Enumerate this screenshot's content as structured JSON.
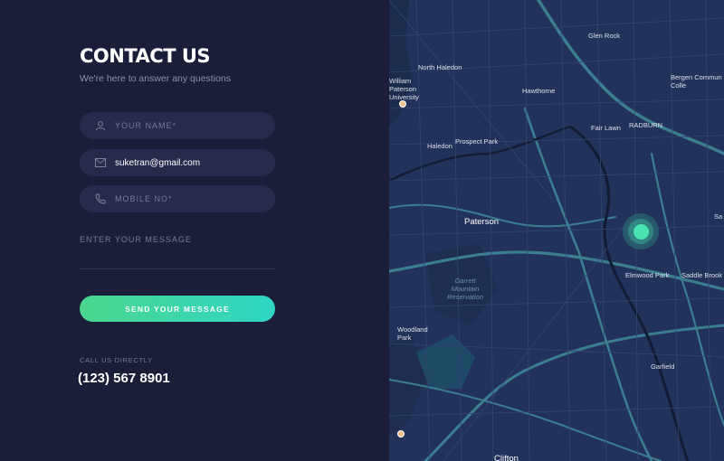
{
  "contact": {
    "title": "CONTACT US",
    "subtitle": "We're here to answer any questions",
    "name_placeholder": "YOUR NAME*",
    "email_value": "suketran@gmail.com",
    "mobile_placeholder": "MOBILE NO*",
    "message_placeholder": "ENTER YOUR MESSAGE",
    "send_label": "SEND YOUR MESSAGE",
    "call_label": "CALL US DIRECTLY",
    "phone": "(123) 567 8901"
  },
  "icons": {
    "name": "user-icon",
    "email": "envelope-icon",
    "mobile": "phone-icon"
  },
  "map": {
    "labels": {
      "glen_rock": "Glen Rock",
      "north_haledon": "North Haledon",
      "william_paterson": "William\nPaterson\nUniversity",
      "hawthorne": "Hawthorne",
      "bergen": "Bergen Commun\nColle",
      "radburn": "RADBURN",
      "fair_lawn": "Fair Lawn",
      "prospect_park": "Prospect Park",
      "haledon": "Haledon",
      "paterson": "Paterson",
      "sa": "Sa",
      "garrett": "Garrett\nMountain\nReservation",
      "elmwood_park": "Elmwood Park",
      "saddle_brook": "Saddle Brook",
      "woodland_park": "Woodland\nPark",
      "garfield": "Garfield",
      "clifton": "Clifton"
    }
  },
  "colors": {
    "background": "#1b1e38",
    "field": "#262a4b",
    "accent_start": "#4bd68f",
    "accent_end": "#2fd6c4",
    "map_bg": "#23325a",
    "map_road": "#3a7f8e",
    "marker": "#48e3b1"
  }
}
